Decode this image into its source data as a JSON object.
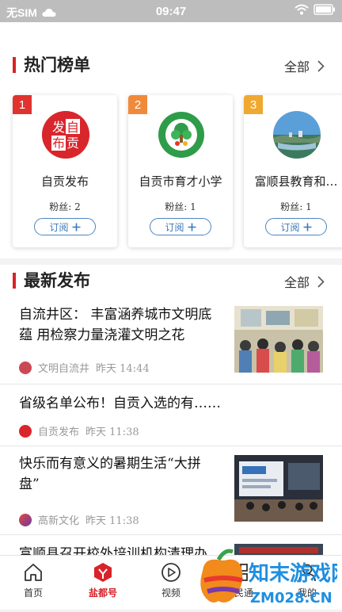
{
  "status_bar": {
    "carrier": "无SIM",
    "time": "09:47"
  },
  "hot": {
    "title": "热门榜单",
    "more": "全部",
    "cards": [
      {
        "rank": "1",
        "rank_color": "#e0322e",
        "name": "自贡发布",
        "fans": "粉丝: 2",
        "subscribe": "订阅",
        "logo_text": [
          "发",
          "自",
          "布",
          "贡"
        ]
      },
      {
        "rank": "2",
        "rank_color": "#f08a3a",
        "name": "自贡市育才小学",
        "fans": "粉丝: 1",
        "subscribe": "订阅"
      },
      {
        "rank": "3",
        "rank_color": "#f0a830",
        "name": "富顺县教育和…",
        "fans": "粉丝: 1",
        "subscribe": "订阅"
      }
    ]
  },
  "latest": {
    "title": "最新发布",
    "more": "全部",
    "items": [
      {
        "title_line1": "自流井区： 丰富涵养城市文明底",
        "title_line2": "蕴 用检察力量浇灌文明之花",
        "source": "文明自流井",
        "time": "昨天 14:44"
      },
      {
        "title_line1": "省级名单公布！自贡入选的有……",
        "source": "自贡发布",
        "time": "昨天 11:38"
      },
      {
        "title_line1": "快乐而有意义的暑期生活“大拼",
        "title_line2": "盘”",
        "source": "高新文化",
        "time": "昨天 11:38"
      },
      {
        "title_line1": "富顺县召开校外培训机构清理办"
      }
    ]
  },
  "tabs": [
    {
      "label": "首页",
      "icon": "home-icon"
    },
    {
      "label": "盐都号",
      "icon": "yandu-icon",
      "active": true
    },
    {
      "label": "视频",
      "icon": "play-icon"
    },
    {
      "label": "市民通",
      "icon": "grid-icon"
    },
    {
      "label": "我的",
      "icon": "user-icon"
    }
  ],
  "watermark": {
    "text": "知末游戏网",
    "sub": "ZM028.CN"
  },
  "colors": {
    "accent": "#d8232a",
    "link_blue": "#3c78b8"
  }
}
